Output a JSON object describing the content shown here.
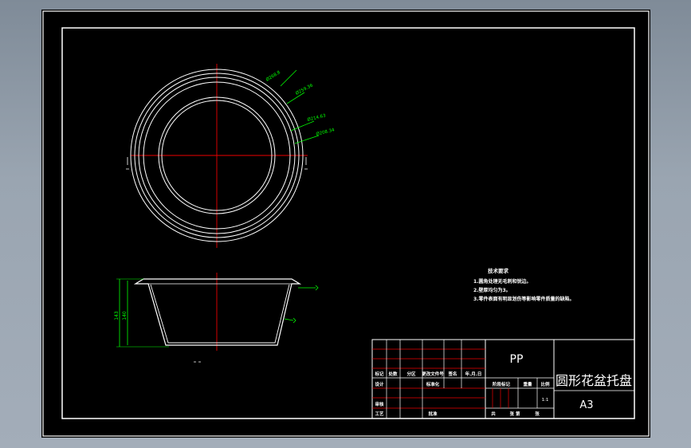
{
  "drawing": {
    "title": "圆形花盆托盘",
    "material": "PP",
    "sheet_size": "A3",
    "scale": "1:1",
    "dimensions": {
      "dia_outer_1": "Ø268.8",
      "dia_outer_2": "Ø259.36",
      "dia_inner_1": "Ø214.63",
      "dia_inner_2": "Ø208.34",
      "height_total": "143",
      "height_inner": "140"
    },
    "tech_requirements": {
      "heading": "技术要求",
      "items": [
        "1.圆角处理无毛刺和锐边。",
        "2.壁厚均匀为3。",
        "3.零件表面有明显划伤等影响零件质量的缺陷。"
      ]
    },
    "title_block": {
      "mark": "标记",
      "count": "处数",
      "zone": "分区",
      "change_doc": "更改文件号",
      "sign": "签名",
      "date": "年.月.日",
      "design": "设计",
      "standardize": "标准化",
      "stage_mark": "阶段标记",
      "weight": "重量",
      "ratio": "比例",
      "review": "审核",
      "process": "工艺",
      "approve": "批准",
      "total_sheets": "共",
      "sheet_no": "张 第",
      "sheet_suffix": "张"
    }
  }
}
